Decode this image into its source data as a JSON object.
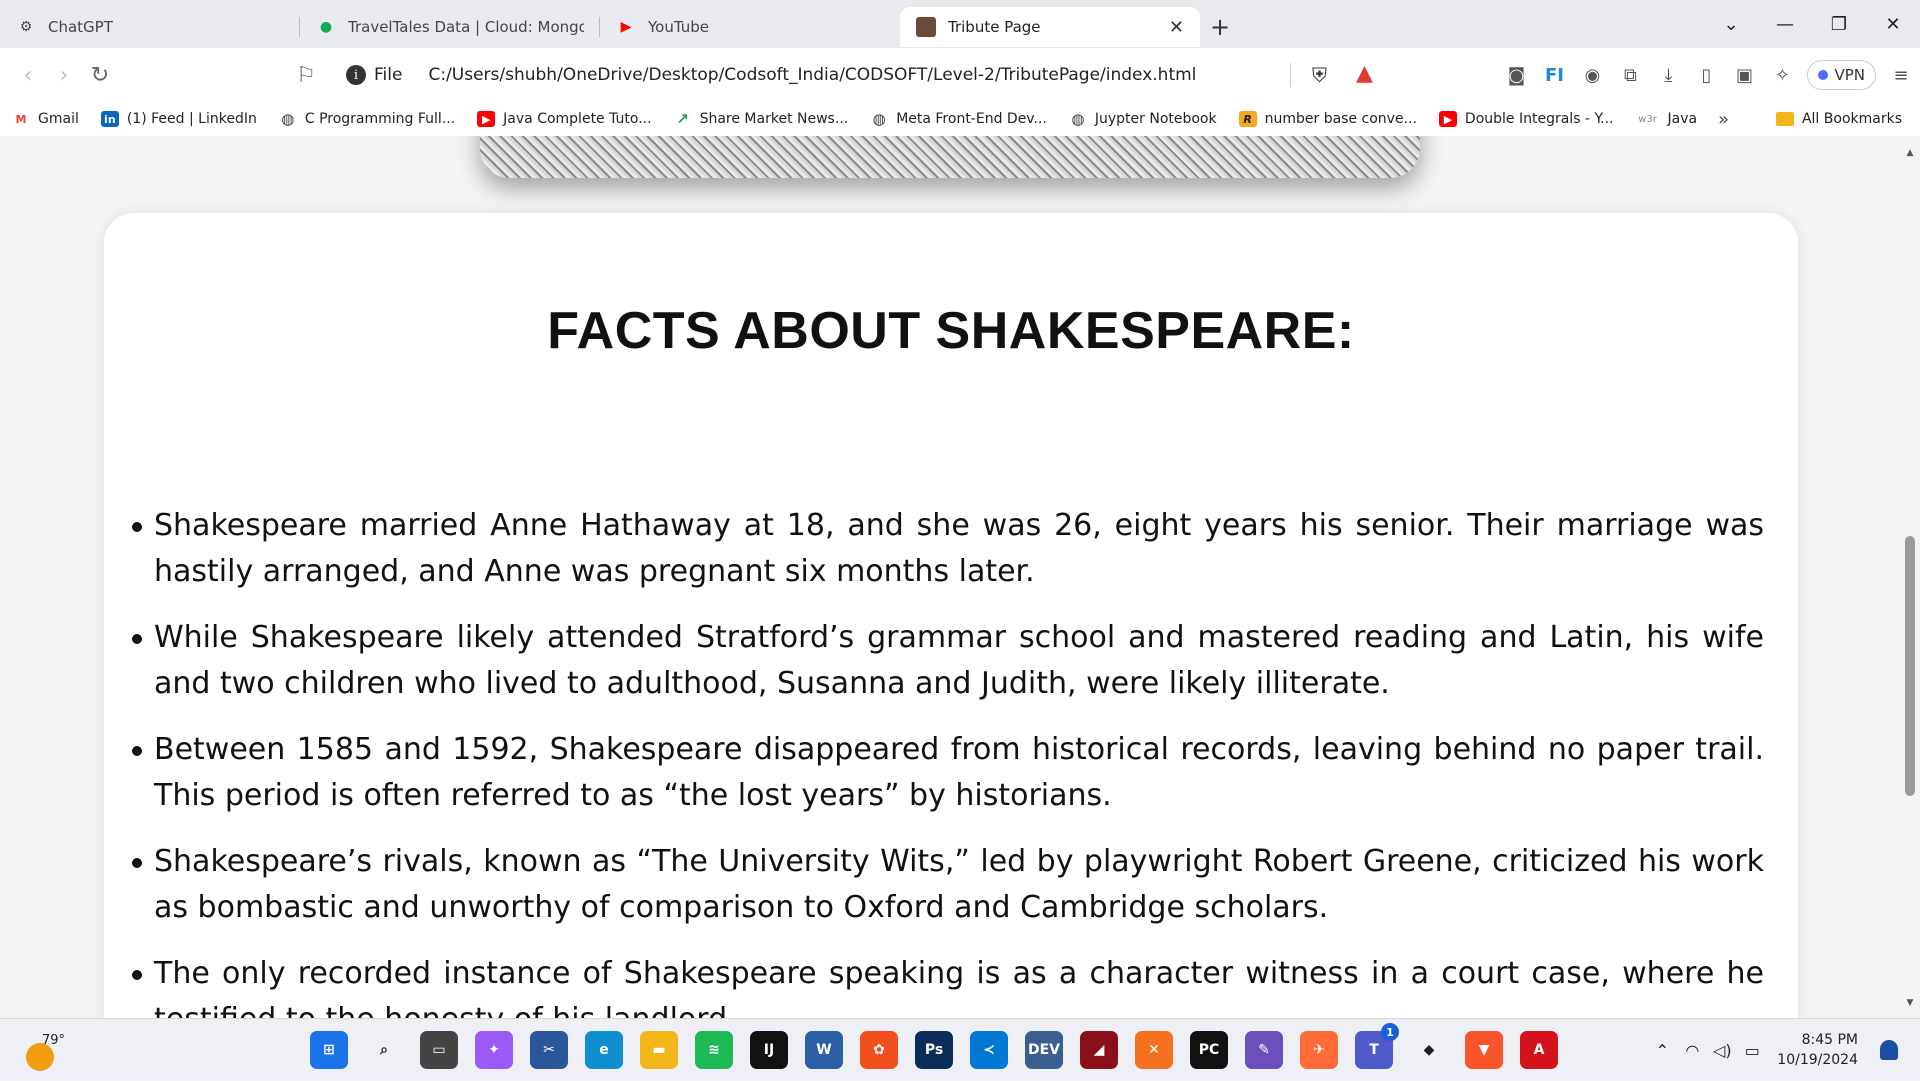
{
  "tabs": [
    {
      "label": "ChatGPT",
      "icon": "chatgpt-icon"
    },
    {
      "label": "TravelTales Data | Cloud: MongoDB C",
      "icon": "mongodb-icon"
    },
    {
      "label": "YouTube",
      "icon": "youtube-icon"
    },
    {
      "label": "Tribute Page",
      "icon": "shakespeare-portrait-icon",
      "active": true
    }
  ],
  "address": {
    "scheme": "File",
    "url": "C:/Users/shubh/OneDrive/Desktop/Codsoft_India/CODSOFT/Level-2/TributePage/index.html"
  },
  "vpn_label": "VPN",
  "bookmarks": [
    {
      "label": "Gmail",
      "icon": "gmail-icon"
    },
    {
      "label": "(1) Feed | LinkedIn",
      "icon": "linkedin-icon"
    },
    {
      "label": "C Programming Full...",
      "icon": "globe-icon"
    },
    {
      "label": "Java Complete Tuto...",
      "icon": "youtube-icon"
    },
    {
      "label": "Share Market News...",
      "icon": "chart-icon"
    },
    {
      "label": "Meta Front-End Dev...",
      "icon": "globe-icon"
    },
    {
      "label": "Juypter Notebook",
      "icon": "globe-icon"
    },
    {
      "label": "number base conve...",
      "icon": "r-icon"
    },
    {
      "label": "Double Integrals - Y...",
      "icon": "youtube-icon"
    },
    {
      "label": "Java",
      "icon": "w3schools-icon",
      "icon_text": "w3r"
    }
  ],
  "all_bookmarks_label": "All Bookmarks",
  "page": {
    "heading": "FACTS ABOUT SHAKESPEARE:",
    "facts": [
      "Shakespeare married Anne Hathaway at 18, and she was 26, eight years his senior. Their marriage was hastily arranged, and Anne was pregnant six months later.",
      "While Shakespeare likely attended Stratford’s grammar school and mastered reading and Latin, his wife and two children who lived to adulthood, Susanna and Judith, were likely illiterate.",
      "Between 1585 and 1592, Shakespeare disappeared from historical records, leaving behind no paper trail. This period is often referred to as “the lost years” by historians.",
      "Shakespeare’s rivals, known as “The University Wits,” led by playwright Robert Greene, criticized his work as bombastic and unworthy of comparison to Oxford and Cambridge scholars.",
      "The only recorded instance of Shakespeare speaking is as a character witness in a court case, where he testified to the honesty of his landlord."
    ]
  },
  "taskbar": {
    "temperature": "79°",
    "time": "8:45 PM",
    "date": "10/19/2024",
    "teams_badge": "1",
    "apps": [
      {
        "name": "windows-start-icon",
        "color": "#1a73e8",
        "text": "⊞"
      },
      {
        "name": "search-icon",
        "color": "#eef0f5",
        "text": "⌕"
      },
      {
        "name": "task-view-icon",
        "color": "#444",
        "text": "▭"
      },
      {
        "name": "copilot-icon",
        "color": "#9b59f6",
        "text": "✦"
      },
      {
        "name": "snipping-icon",
        "color": "#2b579a",
        "text": "✂"
      },
      {
        "name": "edge-icon",
        "color": "#0f8fcf",
        "text": "e"
      },
      {
        "name": "file-explorer-icon",
        "color": "#f2b619",
        "text": "▬"
      },
      {
        "name": "spotify-icon",
        "color": "#1db954",
        "text": "≋"
      },
      {
        "name": "intellij-icon",
        "color": "#111",
        "text": "IJ"
      },
      {
        "name": "wps-icon",
        "color": "#2d5fa8",
        "text": "W"
      },
      {
        "name": "figma-icon",
        "color": "#f24e1e",
        "text": "✿"
      },
      {
        "name": "photoshop-icon",
        "color": "#0a2d5a",
        "text": "Ps"
      },
      {
        "name": "vscode-icon",
        "color": "#0078d4",
        "text": "≺"
      },
      {
        "name": "dev-cpp-icon",
        "color": "#3a5f8f",
        "text": "DEV"
      },
      {
        "name": "mysql-workbench-icon",
        "color": "#8b0f1a",
        "text": "◢"
      },
      {
        "name": "xampp-icon",
        "color": "#f5701e",
        "text": "✕"
      },
      {
        "name": "pycharm-icon",
        "color": "#111",
        "text": "PC"
      },
      {
        "name": "snip-sketch-icon",
        "color": "#6b4fbb",
        "text": "✎"
      },
      {
        "name": "postman-icon",
        "color": "#ff6c37",
        "text": "✈"
      },
      {
        "name": "teams-icon",
        "color": "#5059c9",
        "text": "T"
      },
      {
        "name": "mongodb-compass-icon",
        "color": "#eef0f5",
        "text": "◆"
      },
      {
        "name": "brave-icon",
        "color": "#fb542b",
        "text": "▼"
      },
      {
        "name": "acrobat-icon",
        "color": "#d4121b",
        "text": "A"
      }
    ]
  }
}
